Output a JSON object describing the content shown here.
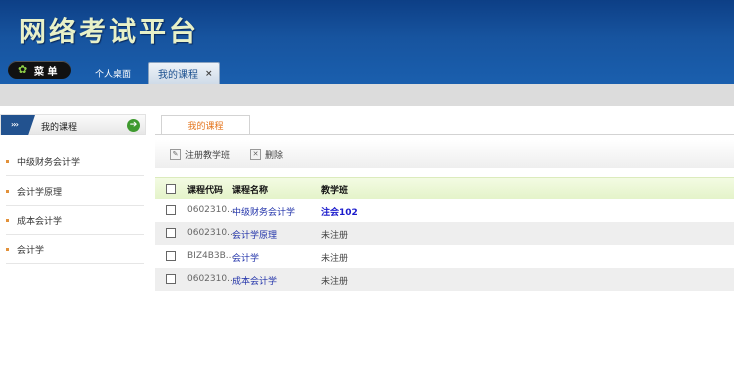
{
  "header": {
    "app_title": "网络考试平台",
    "menu_label": "菜 单",
    "tabs": [
      {
        "label": "个人桌面"
      },
      {
        "label": "我的课程",
        "close": "×"
      }
    ]
  },
  "sidebar": {
    "title": "我的课程",
    "arrow": "›››",
    "items": [
      {
        "label": "中级财务会计学"
      },
      {
        "label": "会计学原理"
      },
      {
        "label": "成本会计学"
      },
      {
        "label": "会计学"
      }
    ]
  },
  "main": {
    "tab_label": "我的课程",
    "toolbar": {
      "register": "注册教学班",
      "delete": "删除"
    },
    "columns": {
      "code": "课程代码",
      "name": "课程名称",
      "class": "教学班"
    },
    "rows": [
      {
        "code": "0602310...",
        "name": "中级财务会计学",
        "class": "注会102"
      },
      {
        "code": "0602310...",
        "name": "会计学原理",
        "class": "未注册"
      },
      {
        "code": "BIZ4B3B...",
        "name": "会计学",
        "class": "未注册"
      },
      {
        "code": "0602310...",
        "name": "成本会计学",
        "class": "未注册"
      }
    ]
  },
  "colors": {
    "header_blue": "#1a5fae",
    "accent_orange": "#e5761e",
    "link_blue": "#1a1acc",
    "head_green": "#e4f3c9"
  }
}
